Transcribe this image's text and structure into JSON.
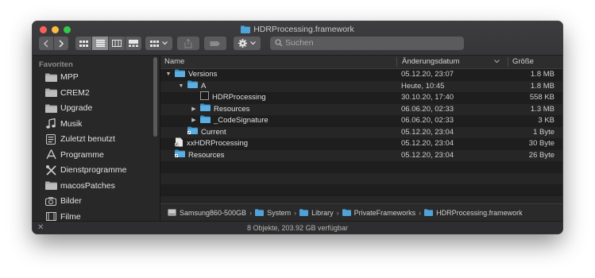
{
  "window": {
    "title": "HDRProcessing.framework"
  },
  "toolbar": {
    "back_icon": "chevron-left-icon",
    "forward_icon": "chevron-right-icon",
    "view_modes": [
      "icon-view-icon",
      "list-view-icon",
      "column-view-icon",
      "gallery-view-icon"
    ],
    "active_view": "list-view-icon",
    "group_icon": "group-by-icon",
    "share_icon": "share-icon",
    "tag_icon": "tag-icon",
    "action_icon": "gear-icon",
    "search": {
      "placeholder": "Suchen"
    }
  },
  "sidebar": {
    "heading": "Favoriten",
    "items": [
      {
        "label": "MPP",
        "icon": "folder-icon"
      },
      {
        "label": "CREM2",
        "icon": "folder-icon"
      },
      {
        "label": "Upgrade",
        "icon": "folder-icon"
      },
      {
        "label": "Musik",
        "icon": "music-note-icon"
      },
      {
        "label": "Zuletzt benutzt",
        "icon": "recents-icon"
      },
      {
        "label": "Programme",
        "icon": "applications-icon"
      },
      {
        "label": "Dienstprogramme",
        "icon": "utilities-icon"
      },
      {
        "label": "macosPatches",
        "icon": "folder-icon"
      },
      {
        "label": "Bilder",
        "icon": "camera-icon"
      },
      {
        "label": "Filme",
        "icon": "film-icon"
      }
    ]
  },
  "columns": {
    "name": "Name",
    "date": "Änderungsdatum",
    "size": "Größe"
  },
  "files": [
    {
      "name": "Versions",
      "date": "05.12.20, 23:07",
      "size": "1.8 MB",
      "icon": "folder-icon",
      "level": 0,
      "disclosure": "open"
    },
    {
      "name": "A",
      "date": "Heute, 10:45",
      "size": "1.8 MB",
      "icon": "folder-icon",
      "level": 1,
      "disclosure": "open"
    },
    {
      "name": "HDRProcessing",
      "date": "30.10.20, 17:40",
      "size": "558 KB",
      "icon": "executable-icon",
      "level": 2,
      "disclosure": "none"
    },
    {
      "name": "Resources",
      "date": "06.06.20, 02:33",
      "size": "1.3 MB",
      "icon": "folder-icon",
      "level": 2,
      "disclosure": "closed"
    },
    {
      "name": "_CodeSignature",
      "date": "06.06.20, 02:33",
      "size": "3 KB",
      "icon": "folder-icon",
      "level": 2,
      "disclosure": "closed"
    },
    {
      "name": "Current",
      "date": "05.12.20, 23:04",
      "size": "1 Byte",
      "icon": "alias-folder-icon",
      "level": 1,
      "disclosure": "none"
    },
    {
      "name": "xxHDRProcessing",
      "date": "05.12.20, 23:04",
      "size": "30 Byte",
      "icon": "alias-document-icon",
      "level": 0,
      "disclosure": "none"
    },
    {
      "name": "Resources",
      "date": "05.12.20, 23:04",
      "size": "26 Byte",
      "icon": "alias-folder-icon",
      "level": 0,
      "disclosure": "none"
    }
  ],
  "path": [
    {
      "label": "Samsung860-500GB",
      "icon": "hard-drive-icon"
    },
    {
      "label": "System",
      "icon": "folder-icon"
    },
    {
      "label": "Library",
      "icon": "folder-icon"
    },
    {
      "label": "PrivateFrameworks",
      "icon": "folder-icon"
    },
    {
      "label": "HDRProcessing.framework",
      "icon": "folder-icon"
    }
  ],
  "status": {
    "text": "8 Objekte, 203.92 GB verfügbar"
  },
  "colors": {
    "folder": "#4fa3d8",
    "window_bg": "#1e1e1e",
    "sidebar_bg": "#282828"
  }
}
